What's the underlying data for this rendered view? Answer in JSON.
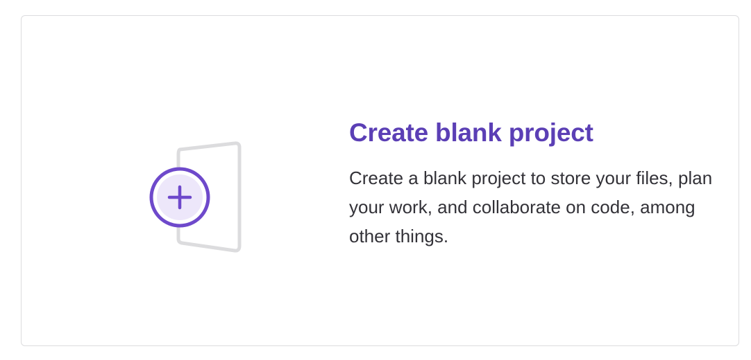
{
  "card": {
    "title": "Create blank project",
    "description": "Create a blank project to store your files, plan your work, and collaborate on code, among other things.",
    "icon": "new-project-illustration"
  },
  "colors": {
    "accent": "#6e49cb",
    "title": "#5b3fb5",
    "text": "#333238",
    "border": "#dcdcde",
    "illustration_gray": "#dcdcde",
    "plus_fill": "#ede7fa"
  }
}
